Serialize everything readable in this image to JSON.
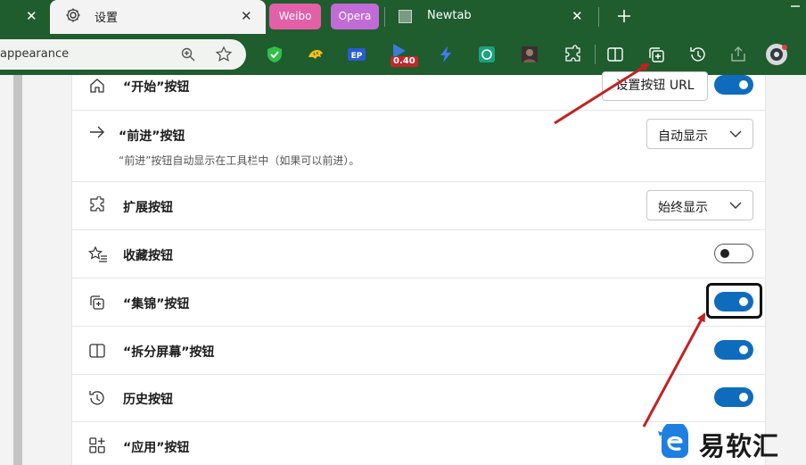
{
  "tabs": {
    "settings": {
      "label": "设置"
    },
    "pinned": [
      {
        "label": "Weibo"
      },
      {
        "label": "Opera"
      }
    ],
    "newtab": {
      "label": "Newtab"
    }
  },
  "toolbar": {
    "address_text": "appearance",
    "extension_badge": "0.40",
    "icons": [
      "zoom-icon",
      "favorite-star-icon",
      "shield-extension-icon",
      "tiger-extension-icon",
      "ep-extension-icon",
      "badge-extension-icon",
      "lightning-extension-icon",
      "openai-extension-icon",
      "avatar-extension-icon",
      "extensions-puzzle-icon",
      "split-screen-icon",
      "collections-icon",
      "history-icon",
      "share-icon",
      "profile-icon"
    ]
  },
  "settings": {
    "rows": [
      {
        "id": "home",
        "title": "“开始”按钮",
        "button": "设置按钮 URL",
        "toggle": true
      },
      {
        "id": "forward",
        "title": "“前进”按钮",
        "desc": "“前进”按钮自动显示在工具栏中（如果可以前进）。",
        "dropdown": "自动显示"
      },
      {
        "id": "extensions",
        "title": "扩展按钮",
        "dropdown": "始终显示"
      },
      {
        "id": "favorites",
        "title": "收藏按钮",
        "toggle": false
      },
      {
        "id": "collections",
        "title": "“集锦”按钮",
        "toggle": true,
        "focused": true
      },
      {
        "id": "split",
        "title": "“拆分屏幕”按钮",
        "toggle": true
      },
      {
        "id": "history",
        "title": "历史按钮",
        "toggle": true
      },
      {
        "id": "apps",
        "title": "“应用”按钮"
      }
    ]
  },
  "watermark": {
    "text": "易软汇"
  },
  "colors": {
    "frame": "#1f5c2e",
    "toggle_on": "#0f6cbd",
    "arrow": "#c42121",
    "watermark_blue": "#1e7fe0"
  }
}
